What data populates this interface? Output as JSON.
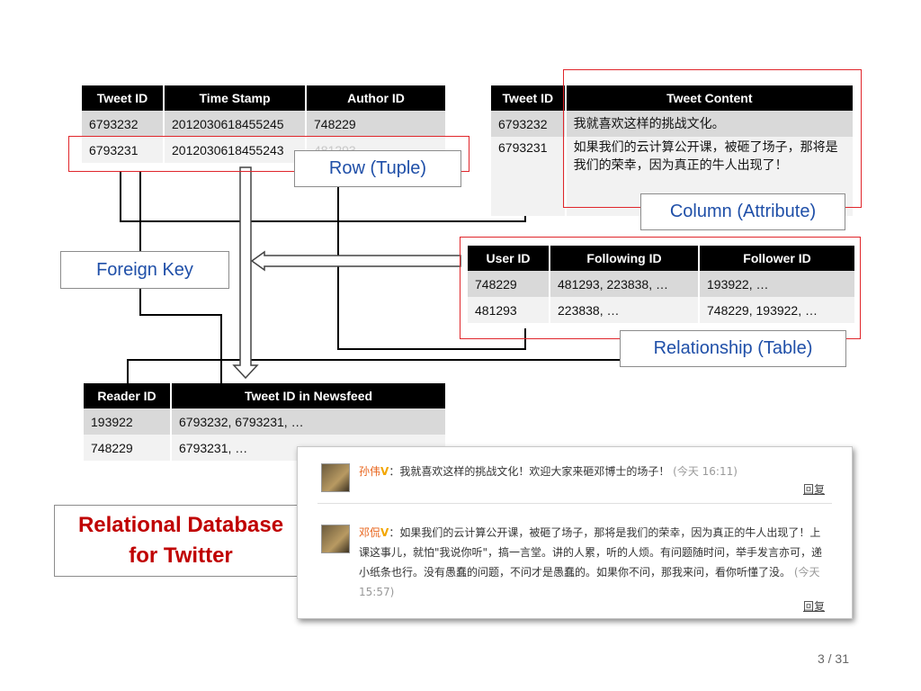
{
  "tweets_table": {
    "headers": [
      "Tweet ID",
      "Time Stamp",
      "Author ID"
    ],
    "rows": [
      [
        "6793232",
        "2012030618455245",
        "748229"
      ],
      [
        "6793231",
        "2012030618455243",
        "481293"
      ]
    ]
  },
  "content_table": {
    "headers": [
      "Tweet ID",
      "Tweet Content"
    ],
    "rows": [
      [
        "6793232",
        "我就喜欢这样的挑战文化。"
      ],
      [
        "6793231",
        "如果我们的云计算公开课，被砸了场子，那将是我们的荣幸，因为真正的牛人出现了！"
      ]
    ]
  },
  "follow_table": {
    "headers": [
      "User ID",
      "Following ID",
      "Follower ID"
    ],
    "rows": [
      [
        "748229",
        "481293, 223838, …",
        "193922, …"
      ],
      [
        "481293",
        "223838, …",
        "748229, 193922, …"
      ]
    ]
  },
  "newsfeed_table": {
    "headers": [
      "Reader ID",
      "Tweet ID in Newsfeed"
    ],
    "rows": [
      [
        "193922",
        "6793232, 6793231, …"
      ],
      [
        "748229",
        "6793231, …"
      ]
    ]
  },
  "labels": {
    "row": "Row (Tuple)",
    "column": "Column (Attribute)",
    "foreign_key": "Foreign Key",
    "relationship": "Relationship (Table)"
  },
  "title": {
    "line1": "Relational Database",
    "line2": "for Twitter"
  },
  "weibo": {
    "post1": {
      "user": "孙伟",
      "badge": "V",
      "text": "：我就喜欢这样的挑战文化！欢迎大家来砸邓博士的场子！",
      "time": "(今天 16:11)",
      "reply": "回复"
    },
    "post2": {
      "user": "邓侃",
      "badge": "V",
      "text": "：如果我们的云计算公开课，被砸了场子，那将是我们的荣幸，因为真正的牛人出现了！上课这事儿，就怕\"我说你听\"，搞一言堂。讲的人累，听的人烦。有问题随时问，举手发言亦可，递小纸条也行。没有愚蠢的问题，不问才是愚蠢的。如果你不问，那我来问，看你听懂了没。",
      "time": "(今天 15:57)",
      "reply": "回复"
    }
  },
  "page_number": "3 / 31",
  "colors": {
    "accent_red": "#e0262b",
    "label_blue": "#1f4fa8",
    "title_red": "#c00000"
  }
}
